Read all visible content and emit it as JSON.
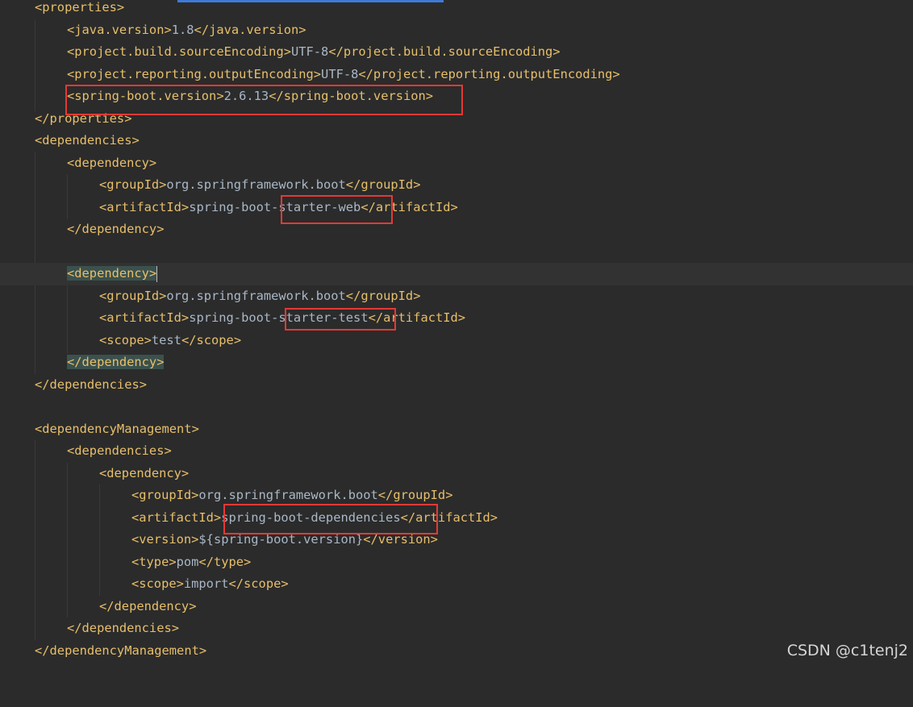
{
  "editor": {
    "lines": [
      {
        "open": "<properties>",
        "text": "",
        "close": ""
      },
      {
        "open": "<java.version>",
        "text": "1.8",
        "close": "</java.version>"
      },
      {
        "open": "<project.build.sourceEncoding>",
        "text": "UTF-8",
        "close": "</project.build.sourceEncoding>"
      },
      {
        "open": "<project.reporting.outputEncoding>",
        "text": "UTF-8",
        "close": "</project.reporting.outputEncoding>"
      },
      {
        "open": "<spring-boot.version>",
        "text": "2.6.13",
        "close": "</spring-boot.version>"
      },
      {
        "open": "</properties>",
        "text": "",
        "close": ""
      },
      {
        "open": "<dependencies>",
        "text": "",
        "close": ""
      },
      {
        "open": "<dependency>",
        "text": "",
        "close": ""
      },
      {
        "open": "<groupId>",
        "text": "org.springframework.boot",
        "close": "</groupId>"
      },
      {
        "open": "<artifactId>",
        "text": "spring-boot-starter-web",
        "close": "</artifactId>"
      },
      {
        "open": "</dependency>",
        "text": "",
        "close": ""
      },
      {
        "open": "",
        "text": "",
        "close": ""
      },
      {
        "open": "<dependency>",
        "text": "",
        "close": ""
      },
      {
        "open": "<groupId>",
        "text": "org.springframework.boot",
        "close": "</groupId>"
      },
      {
        "open": "<artifactId>",
        "text": "spring-boot-starter-test",
        "close": "</artifactId>"
      },
      {
        "open": "<scope>",
        "text": "test",
        "close": "</scope>"
      },
      {
        "open": "</dependency>",
        "text": "",
        "close": ""
      },
      {
        "open": "</dependencies>",
        "text": "",
        "close": ""
      },
      {
        "open": "",
        "text": "",
        "close": ""
      },
      {
        "open": "<dependencyManagement>",
        "text": "",
        "close": ""
      },
      {
        "open": "<dependencies>",
        "text": "",
        "close": ""
      },
      {
        "open": "<dependency>",
        "text": "",
        "close": ""
      },
      {
        "open": "<groupId>",
        "text": "org.springframework.boot",
        "close": "</groupId>"
      },
      {
        "open": "<artifactId>",
        "text": "spring-boot-dependencies",
        "close": "</artifactId>"
      },
      {
        "open": "<version>",
        "text": "${spring-boot.version}",
        "close": "</version>"
      },
      {
        "open": "<type>",
        "text": "pom",
        "close": "</type>"
      },
      {
        "open": "<scope>",
        "text": "import",
        "close": "</scope>"
      },
      {
        "open": "</dependency>",
        "text": "",
        "close": ""
      },
      {
        "open": "</dependencies>",
        "text": "",
        "close": ""
      },
      {
        "open": "</dependencyManagement>",
        "text": "",
        "close": ""
      }
    ]
  },
  "colors": {
    "background": "#2b2b2b",
    "tag": "#e8bf6a",
    "text": "#a9b7c6",
    "annotation_box": "#e53935",
    "matched_tag_highlight": "#3b514d"
  },
  "watermark": "CSDN @c1tenj2"
}
